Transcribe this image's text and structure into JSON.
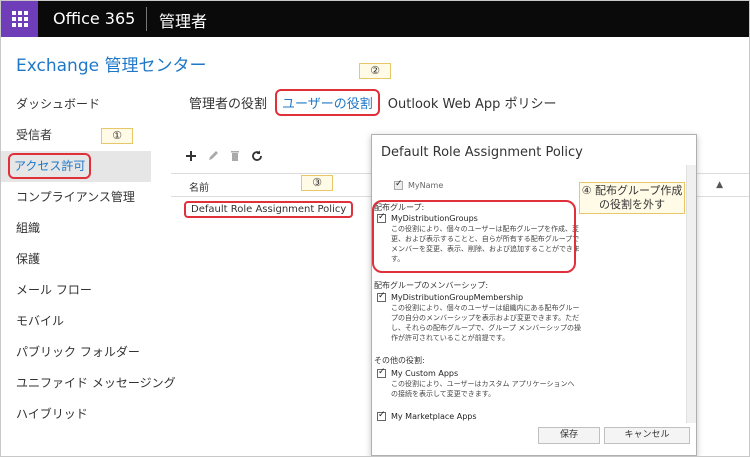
{
  "topbar": {
    "brand": "Office 365",
    "section": "管理者"
  },
  "title": "Exchange 管理センター",
  "nav": {
    "items": [
      {
        "label": "ダッシュボード"
      },
      {
        "label": "受信者"
      },
      {
        "label": "アクセス許可",
        "selected": true
      },
      {
        "label": "コンプライアンス管理"
      },
      {
        "label": "組織"
      },
      {
        "label": "保護"
      },
      {
        "label": "メール フロー"
      },
      {
        "label": "モバイル"
      },
      {
        "label": "パブリック フォルダー"
      },
      {
        "label": "ユニファイド メッセージング"
      },
      {
        "label": "ハイブリッド"
      }
    ]
  },
  "tabs": [
    {
      "label": "管理者の役割"
    },
    {
      "label": "ユーザーの役割",
      "active": true
    },
    {
      "label": "Outlook Web App ポリシー"
    }
  ],
  "callouts": {
    "c1": "①",
    "c2": "②",
    "c3": "③",
    "c4": "④ 配布グループ作成の役割を外す"
  },
  "toolbar_icons": [
    "add-icon",
    "edit-icon",
    "delete-icon",
    "refresh-icon"
  ],
  "list": {
    "column_name": "名前",
    "rows": [
      "Default Role Assignment Policy"
    ]
  },
  "dialog": {
    "title": "Default Role Assignment Policy",
    "top_item": {
      "name": "MyName"
    },
    "groups": [
      {
        "label": "配布グループ:",
        "items": [
          {
            "name": "MyDistributionGroups",
            "desc": "この役割により、個々のユーザーは配布グループを作成、変更、および表示することと、自らが所有する配布グループでメンバーを変更、表示、削除、および追加することができます。"
          }
        ]
      },
      {
        "label": "配布グループのメンバーシップ:",
        "items": [
          {
            "name": "MyDistributionGroupMembership",
            "desc": "この役割により、個々のユーザーは組織内にある配布グループの自分のメンバーシップを表示および変更できます。ただし、それらの配布グループで、グループ メンバーシップの操作が許可されていることが前提です。"
          }
        ]
      },
      {
        "label": "その他の役割:",
        "items": [
          {
            "name": "My Custom Apps",
            "desc": "この役割により、ユーザーはカスタム アプリケーションへの接続を表示して変更できます。"
          },
          {
            "name": "My Marketplace Apps",
            "desc": ""
          }
        ]
      }
    ],
    "save": "保存",
    "cancel": "キャンセル"
  },
  "colors": {
    "accent": "#1f78c7",
    "highlight": "#e0303a",
    "waffle": "#6f3db7"
  }
}
